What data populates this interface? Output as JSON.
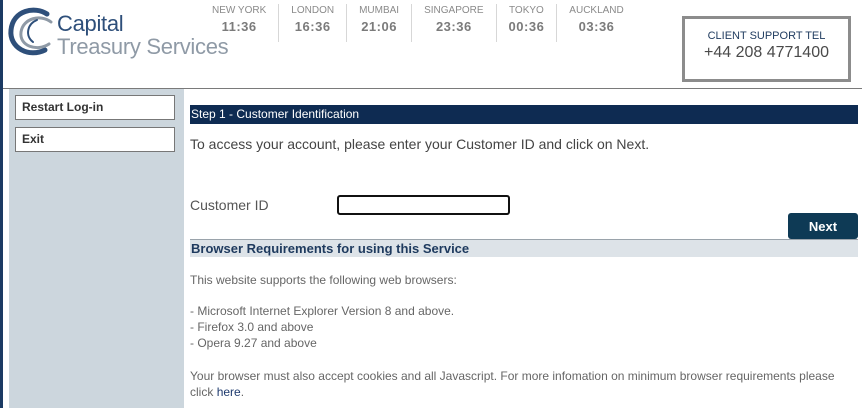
{
  "header": {
    "logo": {
      "line1": "Capital",
      "line2": "Treasury Services"
    },
    "clocks": [
      {
        "city": "NEW YORK",
        "time": "11:36"
      },
      {
        "city": "LONDON",
        "time": "16:36"
      },
      {
        "city": "MUMBAI",
        "time": "21:06"
      },
      {
        "city": "SINGAPORE",
        "time": "23:36"
      },
      {
        "city": "TOKYO",
        "time": "00:36"
      },
      {
        "city": "AUCKLAND",
        "time": "03:36"
      }
    ],
    "support": {
      "label": "CLIENT SUPPORT TEL",
      "phone": "+44 208 4771400"
    }
  },
  "sidebar": {
    "buttons": [
      {
        "label": "Restart Log-in"
      },
      {
        "label": "Exit"
      }
    ]
  },
  "main": {
    "step_title": "Step 1 - Customer Identification",
    "intro": "To access your account, please enter your Customer ID and click on Next.",
    "customer_id_label": "Customer ID",
    "customer_id_value": "",
    "next_label": "Next",
    "requirements": {
      "title": "Browser Requirements for using this Service",
      "intro": "This website supports the following web browsers:",
      "browsers": [
        "- Microsoft Internet Explorer Version 8 and above.",
        "- Firefox 3.0 and above",
        "- Opera 9.27 and above"
      ],
      "note": "Your browser must also accept cookies and all Javascript. For more infomation on minimum browser requirements please click",
      "link_text": "here",
      "note_end": "."
    }
  },
  "colors": {
    "navy": "#0e2b52",
    "sidebar_bg": "#ccd6dd",
    "section_bar": "#dde3e8",
    "next_button": "#0e3a55"
  }
}
